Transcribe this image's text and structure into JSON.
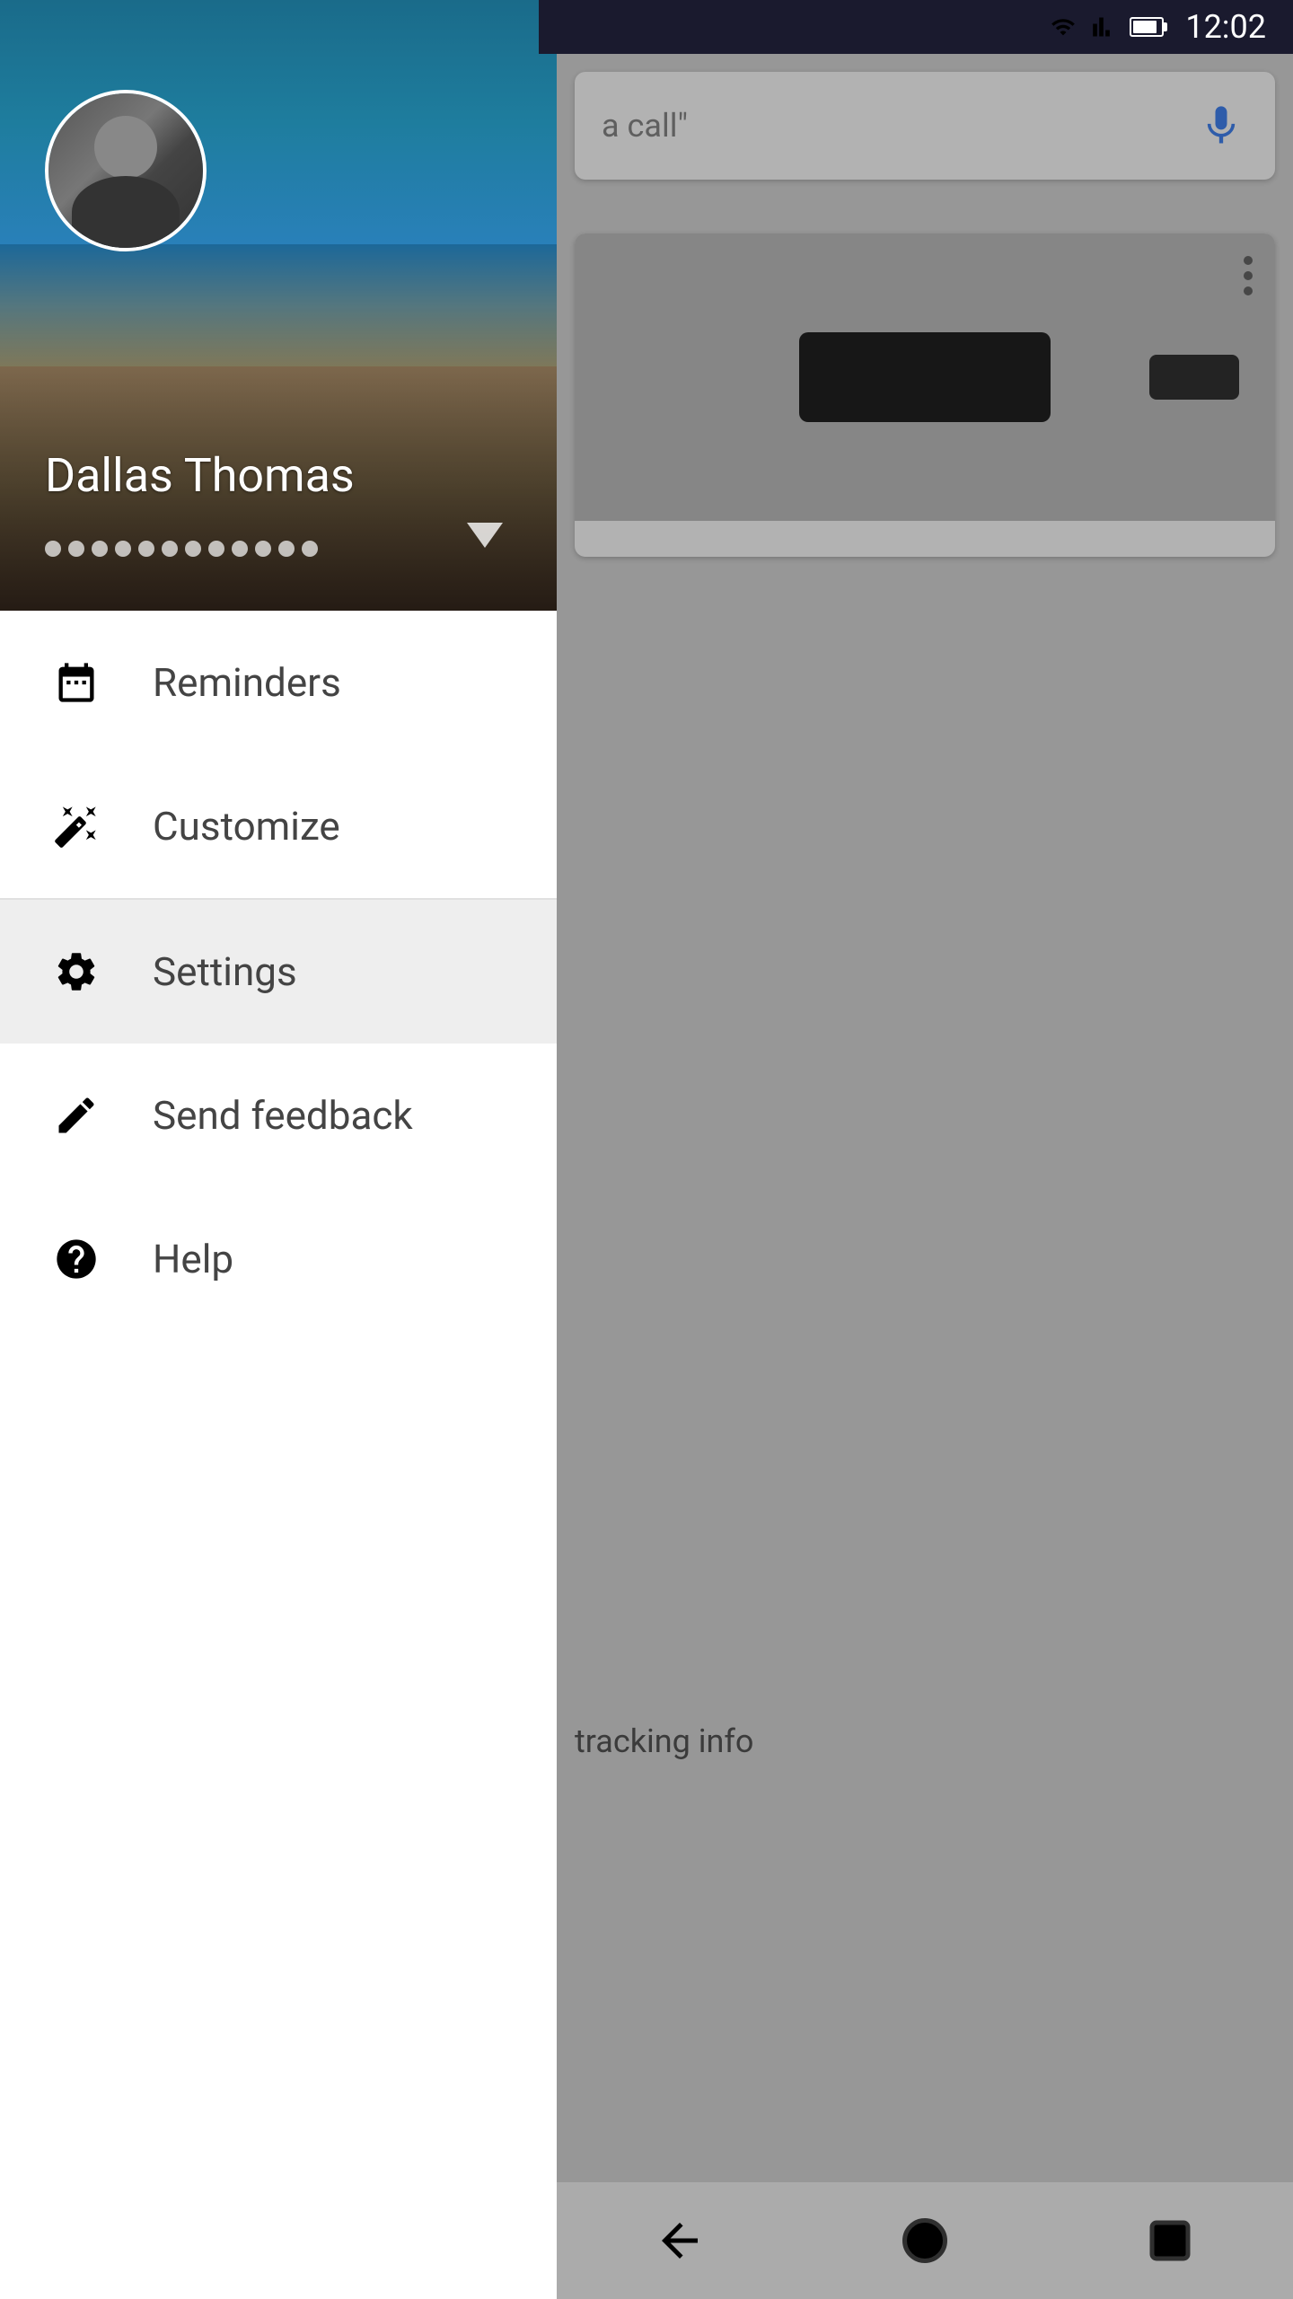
{
  "statusBar": {
    "time": "12:02"
  },
  "drawer": {
    "profile": {
      "name": "Dallas Thomas",
      "emailMasked": "•••• •••• ••••",
      "avatarAlt": "User avatar"
    },
    "menuItems": [
      {
        "id": "reminders",
        "label": "Reminders",
        "icon": "reminders-icon",
        "active": false
      },
      {
        "id": "customize",
        "label": "Customize",
        "icon": "customize-icon",
        "active": false
      },
      {
        "id": "settings",
        "label": "Settings",
        "icon": "settings-icon",
        "active": true
      },
      {
        "id": "send-feedback",
        "label": "Send feedback",
        "icon": "feedback-icon",
        "active": false
      },
      {
        "id": "help",
        "label": "Help",
        "icon": "help-icon",
        "active": false
      }
    ]
  },
  "rightPanel": {
    "search": {
      "placeholder": "a call\"",
      "micLabel": "Voice search"
    },
    "card": {
      "deviceAlt": "Media device with controller",
      "trackingText": "tracking info"
    }
  },
  "bottomNav": {
    "back": "Back",
    "home": "Home",
    "recents": "Recents"
  }
}
